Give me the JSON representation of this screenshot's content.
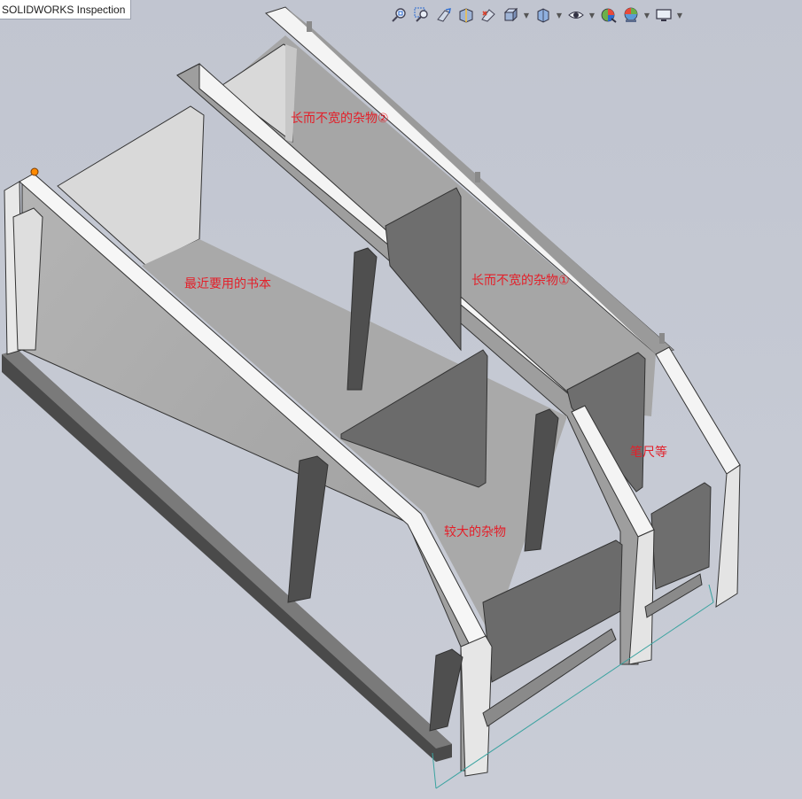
{
  "window": {
    "title": "SOLIDWORKS Inspection"
  },
  "toolbar": {
    "icons": [
      {
        "name": "zoom-to-fit-icon"
      },
      {
        "name": "zoom-to-area-icon"
      },
      {
        "name": "previous-view-icon"
      },
      {
        "name": "section-view-icon"
      },
      {
        "name": "dynamic-annotation-icon"
      },
      {
        "name": "view-orientation-icon",
        "dropdown": true
      },
      {
        "name": "display-style-icon",
        "dropdown": true
      },
      {
        "name": "hide-show-items-icon",
        "dropdown": true
      },
      {
        "name": "edit-appearance-icon"
      },
      {
        "name": "apply-scene-icon",
        "dropdown": true
      },
      {
        "name": "view-settings-icon",
        "dropdown": true
      }
    ]
  },
  "annotations": {
    "recent_books": "最近要用的书本",
    "long_narrow_items_2": "长而不宽的杂物②",
    "long_narrow_items_1": "长而不宽的杂物①",
    "pens_rulers": "笔尺等",
    "larger_items": "较大的杂物"
  },
  "colors": {
    "viewport_bg": "#c4c8d2",
    "annotation": "#e3202a",
    "dimension_line": "#3aa3a0",
    "origin_marker": "#ff8a00"
  }
}
